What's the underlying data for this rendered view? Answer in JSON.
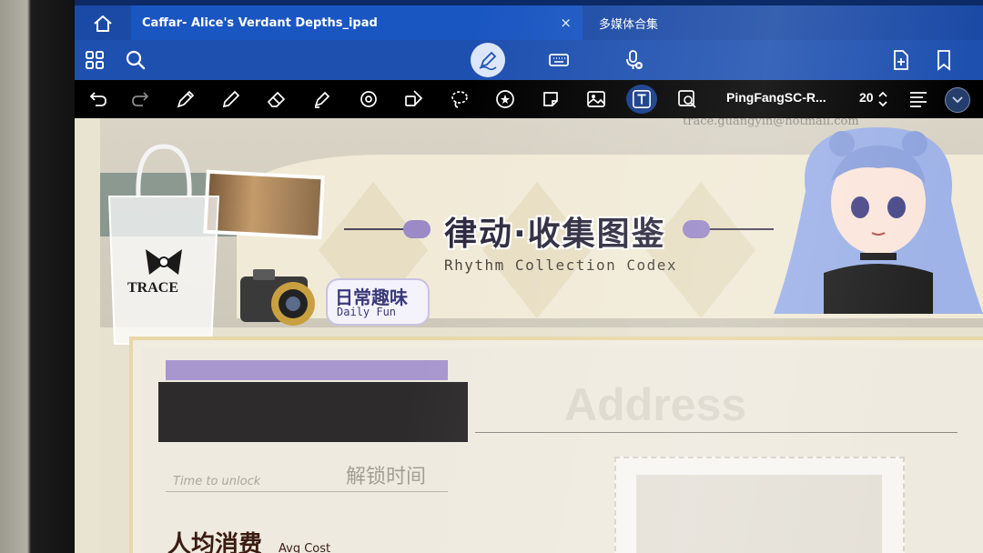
{
  "tabs": [
    {
      "title": "Caffar- Alice's Verdant Depths_ipad",
      "close": "×"
    },
    {
      "title": "多媒体合集"
    }
  ],
  "toolbar": {
    "icons": [
      "grid-icon",
      "search-icon",
      "pen-mode-icon",
      "keyboard-icon",
      "mic-icon",
      "add-page-icon",
      "bookmark-icon"
    ]
  },
  "drawing_tools": {
    "icons": [
      "undo-icon",
      "redo-icon",
      "pen-icon",
      "pencil-icon",
      "eraser-icon",
      "highlighter-icon",
      "shape-icon",
      "lasso-icon",
      "lasso-select-icon",
      "sticker-icon",
      "sticky-note-icon",
      "image-icon",
      "text-icon",
      "zoom-icon"
    ],
    "font_name": "PingFangSC-R...",
    "font_size": "20",
    "active_tool": "text-icon",
    "accent_color": "#1a56c2"
  },
  "document": {
    "title_cn": "律动·收集图鉴",
    "title_en": "Rhythm Collection Codex",
    "badge_cn": "日常趣味",
    "badge_en": "Daily Fun",
    "bag_label": "TRACE",
    "address_label": "Address",
    "unlock_en": "Time to unlock",
    "unlock_cn": "解锁时间",
    "avg_cn": "人均消费",
    "avg_en": "Avg Cost",
    "watermark": "trace.guangyin@hotmail.com",
    "colors": {
      "purple": "#a896cf",
      "teal": "#4f6c6a",
      "cream": "#f1ead7"
    }
  }
}
